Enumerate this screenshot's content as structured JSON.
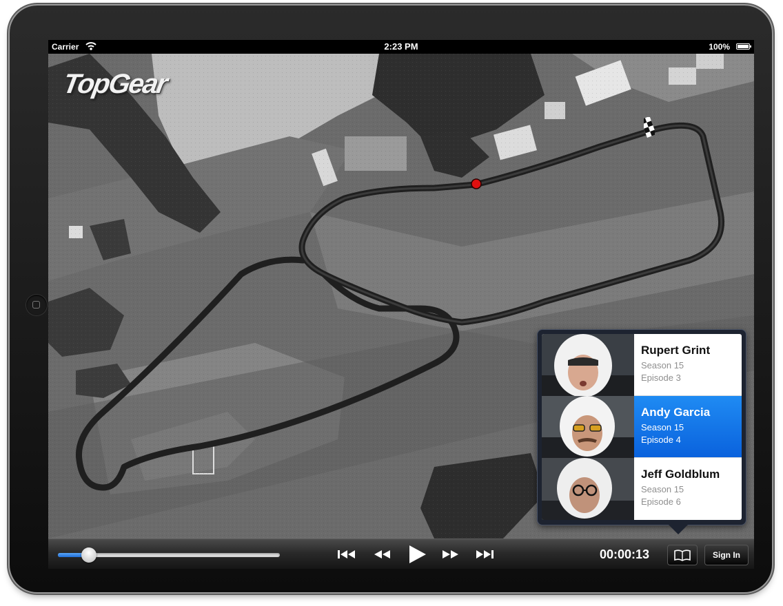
{
  "status_bar": {
    "carrier": "Carrier",
    "time": "2:23 PM",
    "battery": "100%"
  },
  "app": {
    "logo_text": "TopGear"
  },
  "lap_popover": {
    "items": [
      {
        "name": "Rupert Grint",
        "season": "Season 15",
        "episode": "Episode 3",
        "selected": false
      },
      {
        "name": "Andy Garcia",
        "season": "Season 15",
        "episode": "Episode 4",
        "selected": true
      },
      {
        "name": "Jeff Goldblum",
        "season": "Season 15",
        "episode": "Episode 6",
        "selected": false
      }
    ]
  },
  "player": {
    "progress_fraction": 0.14,
    "timecode": "00:00:13",
    "sign_in_label": "Sign In",
    "buttons": [
      "skip-to-start-icon",
      "rewind-icon",
      "play-icon",
      "fast-forward-icon",
      "skip-to-end-icon",
      "book-icon"
    ]
  },
  "colors": {
    "accent_blue": "#0a62dd",
    "marker_red": "#e01010"
  }
}
